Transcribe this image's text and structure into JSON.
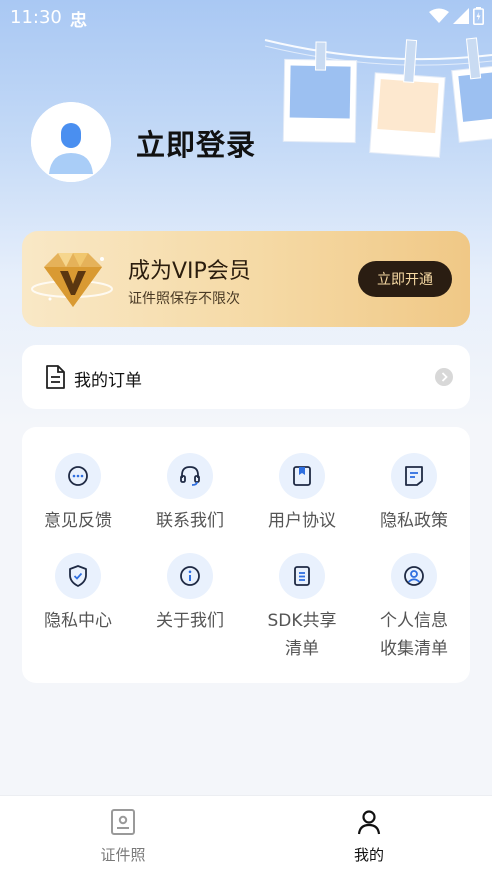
{
  "status_bar": {
    "time": "11:30",
    "notif_glyph": "忠"
  },
  "profile": {
    "login_label": "立即登录"
  },
  "vip": {
    "title": "成为VIP会员",
    "subtitle": "证件照保存不限次",
    "button_label": "立即开通",
    "accent": "#2a1d12",
    "gold": "#f0c886"
  },
  "order": {
    "label": "我的订单",
    "icon": "document-icon"
  },
  "menu": {
    "items": [
      {
        "label": "意见反馈",
        "icon": "chat-bubble-icon"
      },
      {
        "label": "联系我们",
        "icon": "headset-icon"
      },
      {
        "label": "用户协议",
        "icon": "bookmark-doc-icon"
      },
      {
        "label": "隐私政策",
        "icon": "note-icon"
      },
      {
        "label": "隐私中心",
        "icon": "shield-check-icon"
      },
      {
        "label": "关于我们",
        "icon": "info-icon"
      },
      {
        "label": "SDK共享\n清单",
        "icon": "list-doc-icon"
      },
      {
        "label": "个人信息\n收集清单",
        "icon": "user-circle-icon"
      }
    ],
    "icon_color": "#2f6fe0"
  },
  "bottom_nav": {
    "items": [
      {
        "label": "证件照",
        "icon": "id-photo-icon",
        "active": false
      },
      {
        "label": "我的",
        "icon": "person-icon",
        "active": true
      }
    ]
  }
}
